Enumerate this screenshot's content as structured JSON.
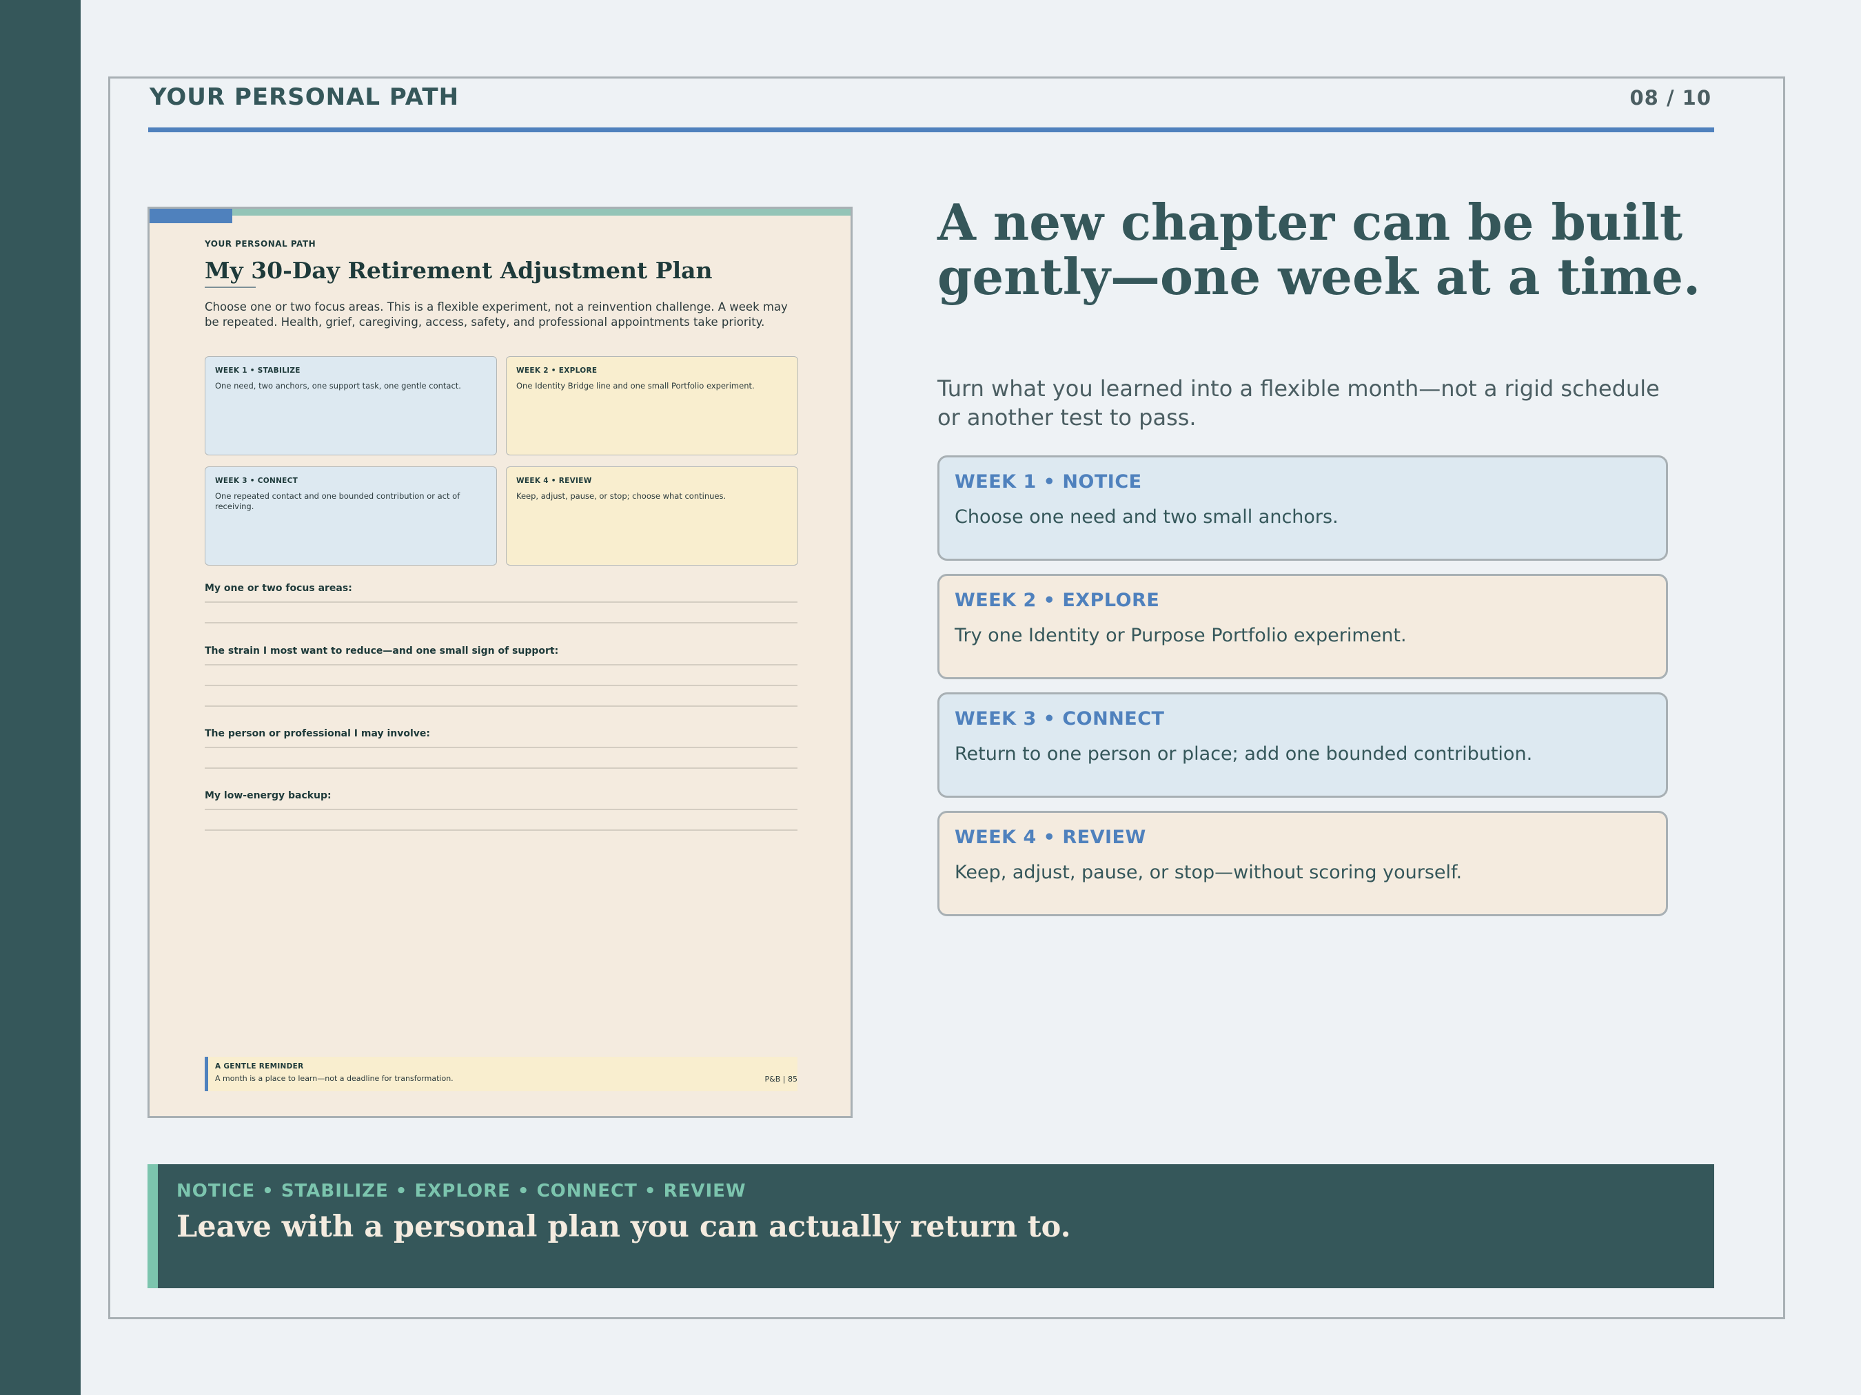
{
  "header": {
    "label": "YOUR PERSONAL PATH",
    "page": "08 / 10"
  },
  "worksheet": {
    "eyebrow": "YOUR PERSONAL PATH",
    "title": "My 30-Day Retirement Adjustment Plan",
    "intro": "Choose one or two focus areas. This is a flexible experiment, not a reinvention challenge. A week may be repeated. Health, grief, caregiving, access, safety, and professional appointments take priority.",
    "cards": [
      {
        "title": "WEEK 1 • STABILIZE",
        "body": "One need, two anchors, one support task, one gentle contact."
      },
      {
        "title": "WEEK 2 • EXPLORE",
        "body": "One Identity Bridge line and one small Portfolio experiment."
      },
      {
        "title": "WEEK 3 • CONNECT",
        "body": "One repeated contact and one bounded contribution or act of receiving."
      },
      {
        "title": "WEEK 4 • REVIEW",
        "body": "Keep, adjust, pause, or stop; choose what continues."
      }
    ],
    "fields": [
      "My one or two focus areas:",
      "The strain I most want to reduce—and one small sign of support:",
      "The person or professional I may involve:",
      "My low-energy backup:"
    ],
    "reminder": {
      "title": "A GENTLE REMINDER",
      "body": "A month is a place to learn—not a deadline for transformation.",
      "page": "P&B  |  85"
    }
  },
  "main": {
    "headline": "A new chapter can be built gently—one week at a time.",
    "subhead": "Turn what you learned into a flexible month—not a rigid schedule or another test to pass.",
    "weeks": [
      {
        "title": "WEEK 1 • NOTICE",
        "body": "Choose one need and two small anchors."
      },
      {
        "title": "WEEK 2 • EXPLORE",
        "body": "Try one Identity or Purpose Portfolio experiment."
      },
      {
        "title": "WEEK 3 • CONNECT",
        "body": "Return to one person or place; add one bounded contribution."
      },
      {
        "title": "WEEK 4 • REVIEW",
        "body": "Keep, adjust, pause, or stop—without scoring yourself."
      }
    ]
  },
  "banner": {
    "eyebrow": "NOTICE • STABILIZE • EXPLORE • CONNECT • REVIEW",
    "title": "Leave with a personal plan you can actually return to."
  },
  "colors": {
    "sidebar": "#35575a",
    "accent_blue": "#4f81bd",
    "accent_mint": "#7cc5ae",
    "background": "#eef2f5"
  }
}
